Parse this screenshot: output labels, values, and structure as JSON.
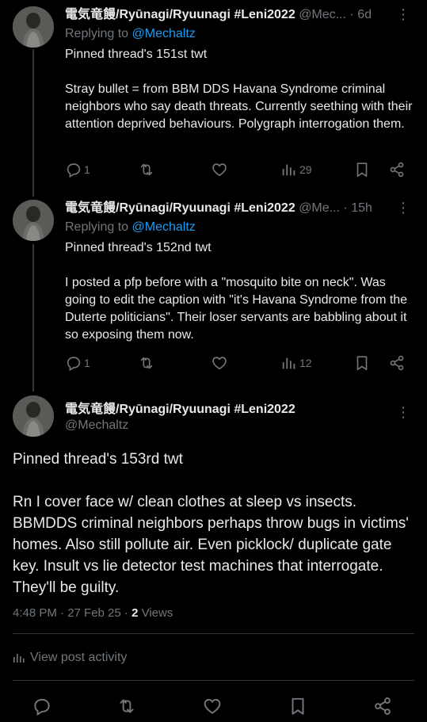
{
  "tweets": [
    {
      "display_name": "電気竜饅/Ryūnagi/Ryuunagi #Leni2022",
      "handle": "@Mec...",
      "time": "6d",
      "replying_label": "Replying to",
      "replying_to": "@Mechaltz",
      "text_line1": "Pinned thread's 151st twt",
      "text_line2": "Stray bullet = from BBM DDS Havana Syndrome criminal neighbors who say death threats. Currently seething with their attention deprived behaviours. Polygraph interrogation them.",
      "replies": "1",
      "views": "29"
    },
    {
      "display_name": "電気竜饅/Ryūnagi/Ryuunagi #Leni2022",
      "handle": "@Me...",
      "time": "15h",
      "replying_label": "Replying to",
      "replying_to": "@Mechaltz",
      "text_line1": "Pinned thread's 152nd twt",
      "text_line2": "I posted a pfp before with a \"mosquito bite on neck\". Was going to edit the caption with \"it's Havana Syndrome from the Duterte politicians\". Their loser servants are babbling about it so exposing them now.",
      "replies": "1",
      "views": "12"
    }
  ],
  "main_tweet": {
    "display_name": "電気竜饅/Ryūnagi/Ryuunagi #Leni2022",
    "handle": "@Mechaltz",
    "text_line1": "Pinned thread's 153rd twt",
    "text_line2": "Rn I cover face w/ clean clothes at sleep vs insects. BBMDDS criminal neighbors perhaps throw bugs in victims' homes. Also still pollute air. Even picklock/ duplicate gate key. Insult vs lie detector test machines that interrogate. They'll be guilty.",
    "timestamp": "4:48 PM · 27 Feb 25 · ",
    "views_count": "2",
    "views_label": " Views",
    "activity_label": "View post activity"
  },
  "separator": "·",
  "more_glyph": "⋮"
}
